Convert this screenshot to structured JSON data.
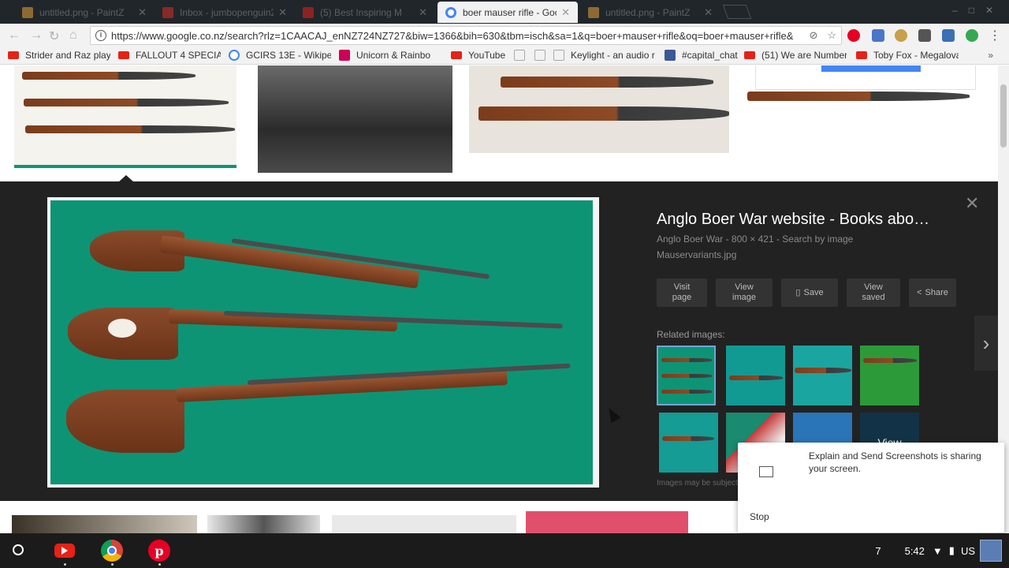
{
  "browser": {
    "tabs": [
      {
        "title": "untitled.png - PaintZ",
        "fav_color": "#e8a33a",
        "active": false
      },
      {
        "title": "Inbox - jumbopenguin2",
        "fav_color": "#d93025",
        "active": false
      },
      {
        "title": "(5) Best Inspiring M",
        "fav_color": "#e62117",
        "active": false
      },
      {
        "title": "boer mauser rifle - Goog",
        "fav_color": "#4285f4",
        "active": true
      },
      {
        "title": "untitled.png - PaintZ",
        "fav_color": "#e8a33a",
        "active": false
      }
    ],
    "url": "https://www.google.co.nz/search?rlz=1CAACAJ_enNZ724NZ727&biw=1366&bih=630&tbm=isch&sa=1&q=boer+mauser+rifle&oq=boer+mauser+rifle&",
    "bookmarks": [
      {
        "label": "Strider and Raz play",
        "icon": "youtube"
      },
      {
        "label": "FALLOUT 4 SPECIAL",
        "icon": "youtube"
      },
      {
        "label": "GCIRS 13E - Wikipedi",
        "icon": "google"
      },
      {
        "label": "Unicorn & Rainbo",
        "icon": "unicorn"
      },
      {
        "label": "YouTube",
        "icon": "youtube"
      },
      {
        "label": "",
        "icon": "page"
      },
      {
        "label": "",
        "icon": "page"
      },
      {
        "label": "Keylight - an audio r",
        "icon": "page"
      },
      {
        "label": "#capital_chat",
        "icon": "chat"
      },
      {
        "label": "(51) We are Number",
        "icon": "youtube"
      },
      {
        "label": "Toby Fox - Megalova",
        "icon": "youtube"
      }
    ],
    "bookmarks_more": "»"
  },
  "preview": {
    "title": "Anglo Boer War website - Books abo…",
    "meta": "Anglo Boer War - 800 × 421 - Search by image",
    "filename": "Mauservariants.jpg",
    "actions": {
      "visit": "Visit page",
      "view_image": "View image",
      "save": "Save",
      "view_saved": "View saved",
      "share": "Share"
    },
    "related_label": "Related images:",
    "view_more": "View",
    "disclaimer": "Images may be subject to copyright.",
    "close": "✕",
    "next": "›"
  },
  "share_notice": {
    "text": "Explain and Send Screenshots is sharing your screen.",
    "stop": "Stop"
  },
  "shelf": {
    "notifications": "7",
    "time": "5:42",
    "locale": "US"
  },
  "colors": {
    "preview_bg": "#222222",
    "image_green": "#0d9475",
    "selected_border": "#6fa6d6"
  }
}
